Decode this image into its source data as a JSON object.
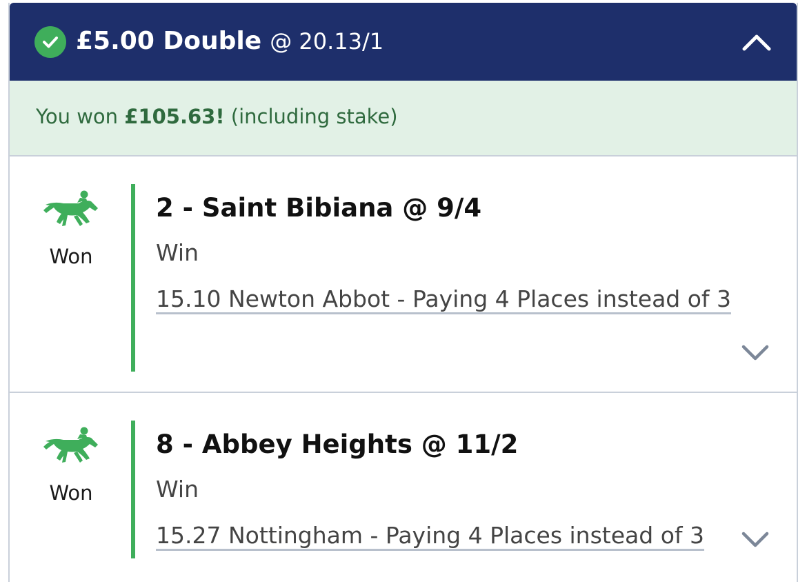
{
  "header": {
    "stake_label": "£5.00 Double",
    "odds_label": "@ 20.13/1",
    "icons": {
      "status": "check-circle-icon",
      "toggle": "chevron-up-icon"
    },
    "colors": {
      "background": "#1e2f6b",
      "check": "#3fae5b"
    }
  },
  "result": {
    "prefix": "You won",
    "amount": "£105.63!",
    "suffix": "(including stake)",
    "colors": {
      "background": "#e2f1e6",
      "text": "#2f6a3e"
    }
  },
  "legs": [
    {
      "status": "Won",
      "selection": "2 - Saint Bibiana @ 9/4",
      "market": "Win",
      "event": "15.10 Newton Abbot - Paying 4 Places instead of 3",
      "icons": {
        "sport": "horse-racing-icon",
        "toggle": "chevron-down-icon"
      }
    },
    {
      "status": "Won",
      "selection": "8 - Abbey Heights @ 11/2",
      "market": "Win",
      "event": "15.27 Nottingham - Paying 4 Places instead of 3",
      "icons": {
        "sport": "horse-racing-icon",
        "toggle": "chevron-down-icon"
      }
    }
  ],
  "colors": {
    "accent_green": "#3fae5b",
    "divider": "#c9d0da"
  }
}
